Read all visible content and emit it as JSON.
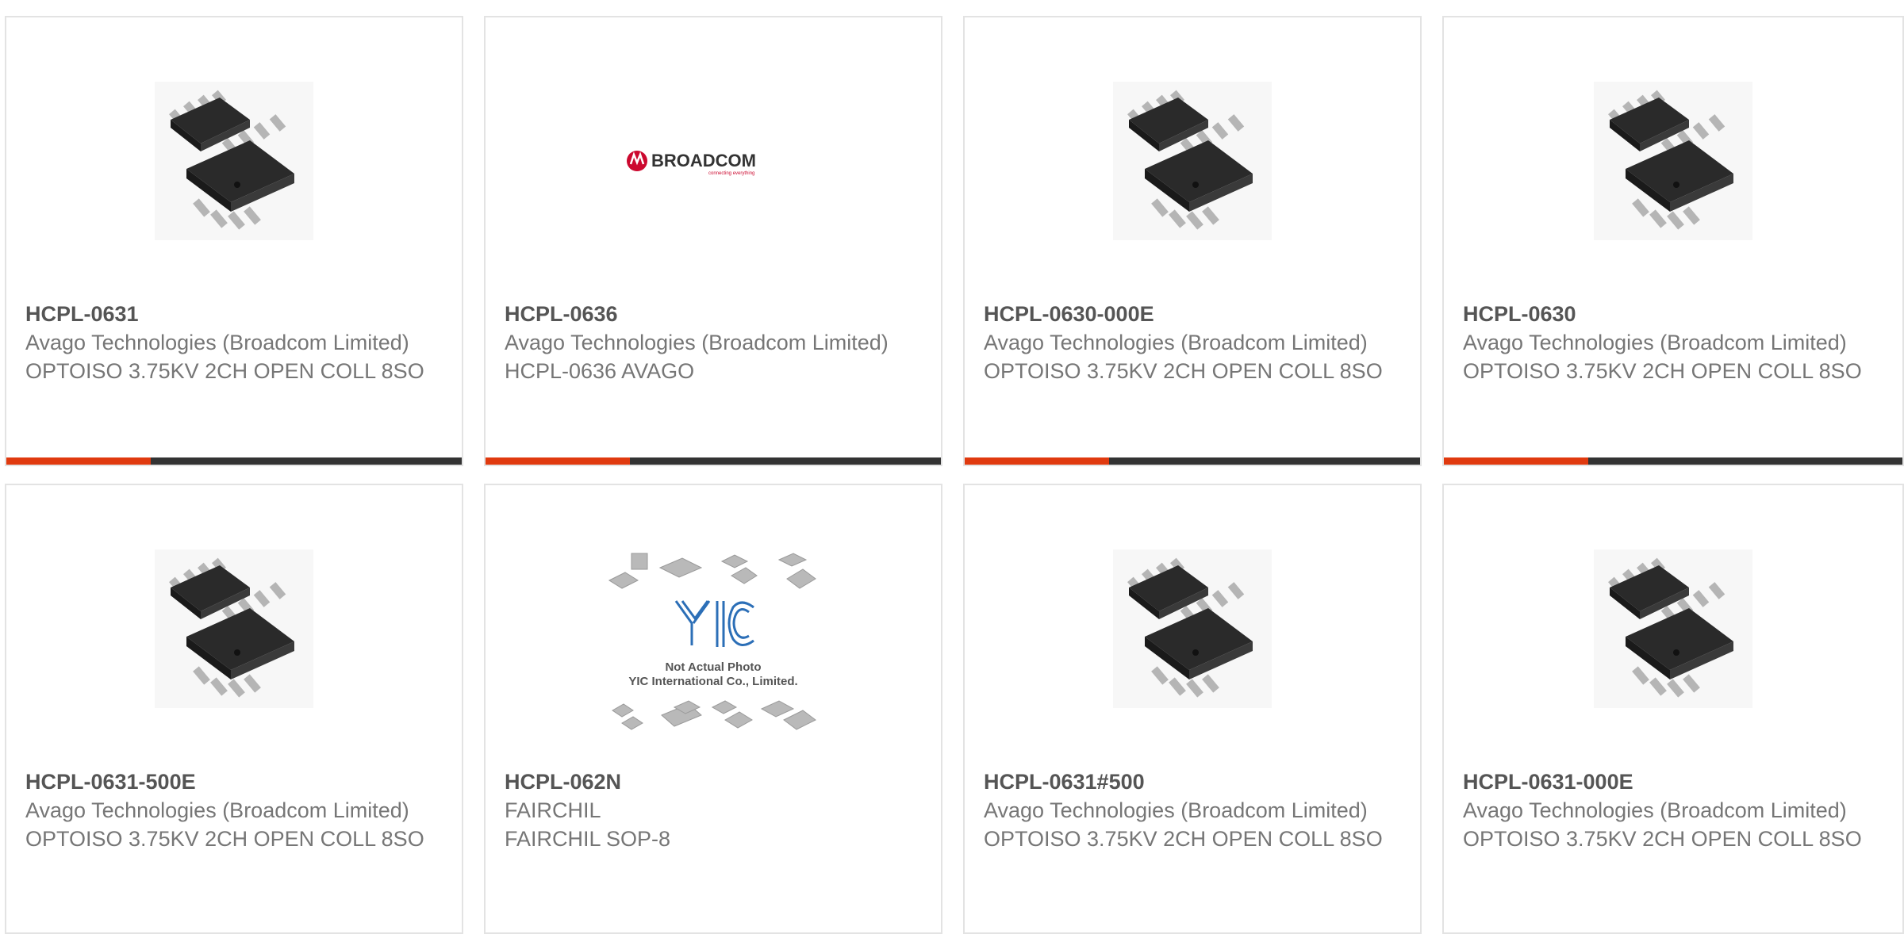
{
  "products": [
    {
      "part_number": "HCPL-0631",
      "manufacturer": "Avago Technologies (Broadcom Limited)",
      "description": "OPTOISO 3.75KV 2CH OPEN COLL 8SO",
      "image": "soic8-chip-photo"
    },
    {
      "part_number": "HCPL-0636",
      "manufacturer": "Avago Technologies (Broadcom Limited)",
      "description": "HCPL-0636 AVAGO",
      "image": "broadcom-logo"
    },
    {
      "part_number": "HCPL-0630-000E",
      "manufacturer": "Avago Technologies (Broadcom Limited)",
      "description": "OPTOISO 3.75KV 2CH OPEN COLL 8SO",
      "image": "soic8-chip-photo"
    },
    {
      "part_number": "HCPL-0630",
      "manufacturer": "Avago Technologies (Broadcom Limited)",
      "description": "OPTOISO 3.75KV 2CH OPEN COLL 8SO",
      "image": "soic8-chip-photo"
    },
    {
      "part_number": "HCPL-0631-500E",
      "manufacturer": "Avago Technologies (Broadcom Limited)",
      "description": "OPTOISO 3.75KV 2CH OPEN COLL 8SO",
      "image": "soic8-chip-photo"
    },
    {
      "part_number": "HCPL-062N",
      "manufacturer": "FAIRCHIL",
      "description": "FAIRCHIL SOP-8",
      "image": "yic-placeholder"
    },
    {
      "part_number": "HCPL-0631#500",
      "manufacturer": "Avago Technologies (Broadcom Limited)",
      "description": "OPTOISO 3.75KV 2CH OPEN COLL 8SO",
      "image": "soic8-chip-photo"
    },
    {
      "part_number": "HCPL-0631-000E",
      "manufacturer": "Avago Technologies (Broadcom Limited)",
      "description": "OPTOISO 3.75KV 2CH OPEN COLL 8SO",
      "image": "soic8-chip-photo"
    }
  ],
  "logos": {
    "broadcom": {
      "name": "BROADCOM",
      "tagline": "connecting everything"
    },
    "yic": {
      "mark": "YIC",
      "line1": "Not Actual Photo",
      "line2": "YIC International Co., Limited."
    }
  },
  "colors": {
    "accent": "#e03a0f",
    "bar": "#333333",
    "border": "#e3e3e3",
    "text": "#767676",
    "title": "#555555"
  }
}
